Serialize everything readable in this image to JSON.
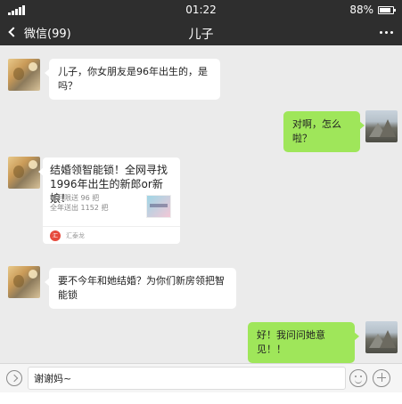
{
  "status_bar": {
    "time": "01:22",
    "battery_percent": "88%",
    "battery_level": 0.88
  },
  "nav": {
    "back_label": "微信(99)",
    "title": "儿子"
  },
  "messages": [
    {
      "sender": "son",
      "type": "text",
      "text": "儿子，你女朋友是96年出生的，是吗？"
    },
    {
      "sender": "me",
      "type": "text",
      "text": "对啊，怎么啦？"
    },
    {
      "sender": "son",
      "type": "article",
      "title": "结婚领智能锁！全网寻找1996年出生的新郎or新娘！",
      "desc_line1": "每月限送 96 把",
      "desc_line2": "全年送出 1152 把",
      "source_icon": "汇",
      "source_name": "汇泰龙"
    },
    {
      "sender": "son",
      "type": "text",
      "text": "要不今年和她结婚？为你们新房领把智能锁"
    },
    {
      "sender": "me",
      "type": "text",
      "text": "好！我问问她意见！！"
    }
  ],
  "input": {
    "value": "谢谢妈~"
  },
  "colors": {
    "bar_bg": "#2e2e2e",
    "chat_bg": "#ebebeb",
    "out_bubble": "#9fe65a",
    "in_bubble": "#ffffff"
  },
  "icons": {
    "signal": "signal-icon",
    "battery": "battery-icon",
    "back": "chevron-left-icon",
    "more": "more-dots-icon",
    "voice": "voice-icon",
    "emoji": "emoji-icon",
    "plus": "plus-icon"
  }
}
